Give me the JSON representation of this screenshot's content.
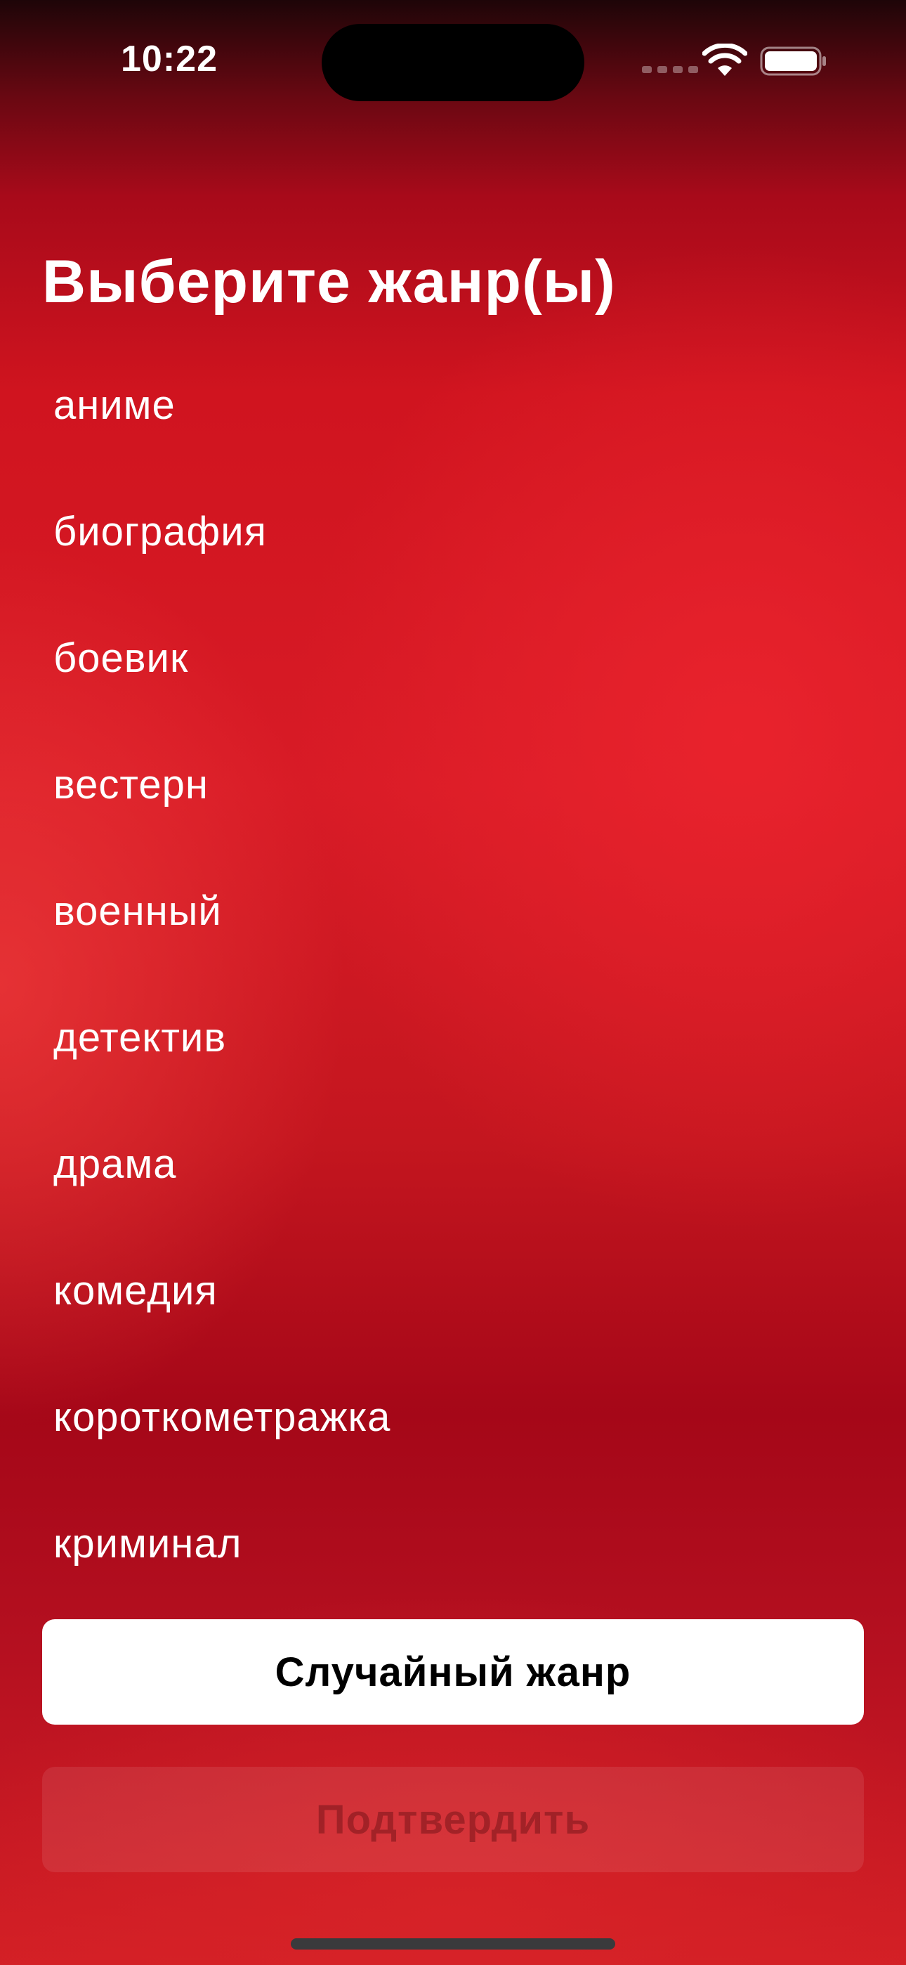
{
  "status_bar": {
    "time": "10:22",
    "icons": [
      "signal-icon",
      "wifi-icon",
      "battery-icon"
    ]
  },
  "title": "Выберите жанр(ы)",
  "genres": [
    "аниме",
    "биография",
    "боевик",
    "вестерн",
    "военный",
    "детектив",
    "драма",
    "комедия",
    "короткометражка",
    "криминал"
  ],
  "buttons": {
    "random_label": "Случайный жанр",
    "confirm_label": "Подтвердить"
  },
  "colors": {
    "background_accent": "#d81b26",
    "button_primary_bg": "#ffffff",
    "button_primary_text": "#000000"
  }
}
